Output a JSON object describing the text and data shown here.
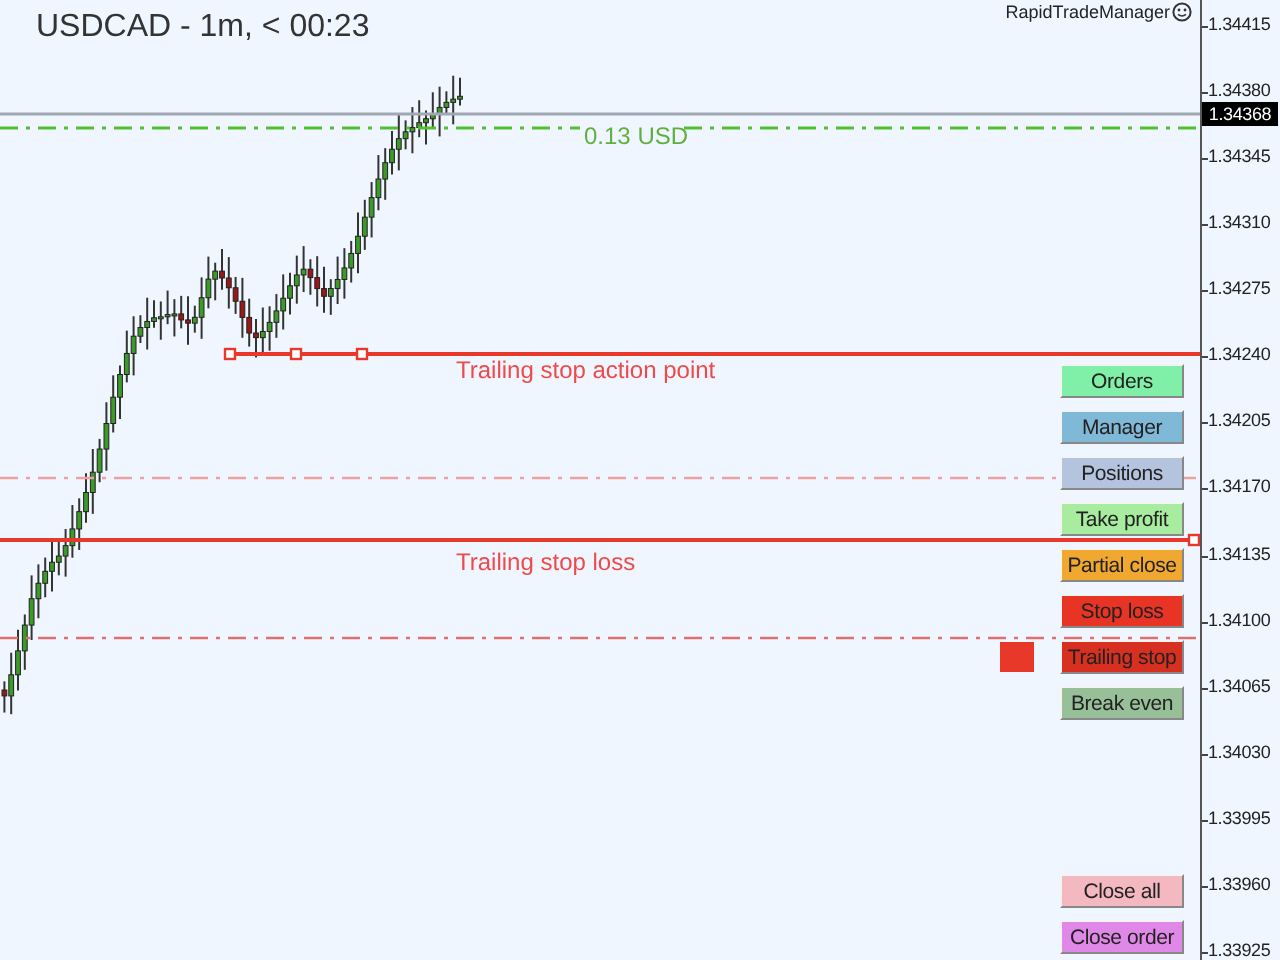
{
  "chart": {
    "title": "USDCAD - 1m, < 00:23",
    "brand": "RapidTradeManager",
    "price_ticks": [
      "1.34415",
      "1.34380",
      "1.34345",
      "1.34310",
      "1.34275",
      "1.34240",
      "1.34205",
      "1.34170",
      "1.34135",
      "1.34100",
      "1.34065",
      "1.34030",
      "1.33995",
      "1.33960",
      "1.33925"
    ],
    "current_price": "1.34368",
    "levels": [
      {
        "kind": "current"
      },
      {
        "kind": "profit",
        "label": "0.13 USD"
      },
      {
        "kind": "action",
        "label": "Trailing stop action point"
      },
      {
        "kind": "pending"
      },
      {
        "kind": "trail",
        "label": "Trailing stop loss"
      },
      {
        "kind": "stop"
      }
    ]
  },
  "panel": {
    "top_buttons": [
      {
        "label": "Orders",
        "color": "#80f0a8",
        "active": false
      },
      {
        "label": "Manager",
        "color": "#80b8d8",
        "active": false
      },
      {
        "label": "Positions",
        "color": "#b4c4de",
        "active": false
      },
      {
        "label": "Take profit",
        "color": "#a8eca0",
        "active": false
      },
      {
        "label": "Partial close",
        "color": "#f0a830",
        "active": false
      },
      {
        "label": "Stop loss",
        "color": "#e83424",
        "active": false
      },
      {
        "label": "Trailing stop",
        "color": "#d83020",
        "active": true
      },
      {
        "label": "Break even",
        "color": "#98c098",
        "active": false
      }
    ],
    "bottom_buttons": [
      {
        "label": "Close all",
        "color": "#f4b8c0",
        "active": false
      },
      {
        "label": "Close order",
        "color": "#e088e8",
        "active": false
      }
    ]
  }
}
